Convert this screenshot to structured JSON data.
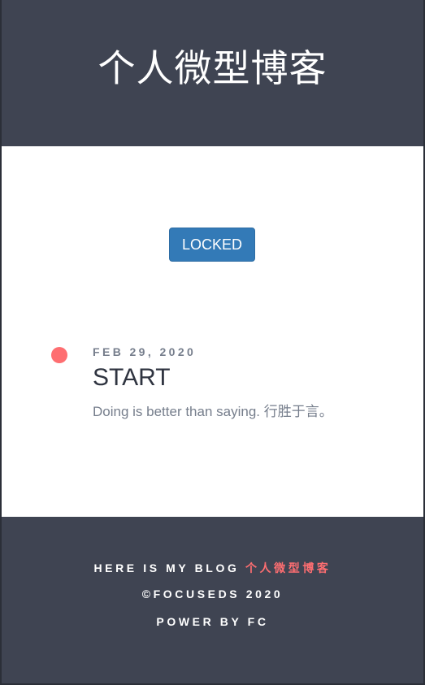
{
  "header": {
    "site_title": "个人微型博客"
  },
  "main": {
    "locked_button_label": "LOCKED",
    "post": {
      "date": "FEB 29, 2020",
      "title": "START",
      "summary": "Doing is better than saying. 行胜于言。"
    }
  },
  "footer": {
    "line1_prefix": "HERE IS MY BLOG ",
    "line1_accent": "个人微型博客",
    "copyright": "©FOCUSEDS 2020",
    "powered_by": "POWER BY FC"
  },
  "colors": {
    "dark_bg": "#3f4452",
    "accent": "#fe6e71",
    "button_blue": "#337ab7",
    "muted_text": "#767e8c",
    "title_text": "#2f3440"
  }
}
